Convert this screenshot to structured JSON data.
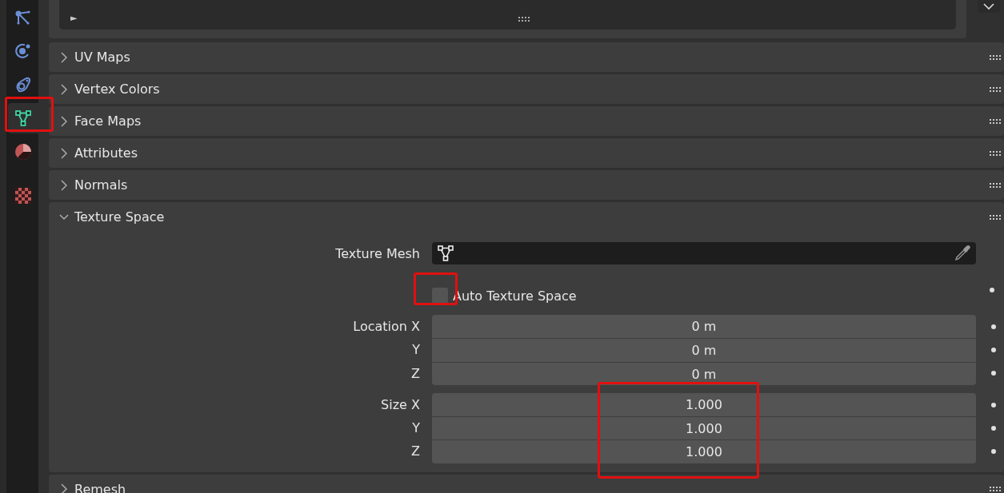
{
  "sidebar": {
    "tabs": [
      {
        "kind": "particles",
        "selected": false
      },
      {
        "kind": "physics",
        "selected": false
      },
      {
        "kind": "constraints",
        "selected": false
      },
      {
        "kind": "mesh",
        "selected": true
      },
      {
        "kind": "material",
        "selected": false
      },
      {
        "kind": "texture",
        "selected": false
      }
    ]
  },
  "top_panel": {
    "toggle": "►"
  },
  "panels": [
    {
      "title": "UV Maps",
      "expanded": false
    },
    {
      "title": "Vertex Colors",
      "expanded": false
    },
    {
      "title": "Face Maps",
      "expanded": false
    },
    {
      "title": "Attributes",
      "expanded": false
    },
    {
      "title": "Normals",
      "expanded": false
    },
    {
      "title": "Texture Space",
      "expanded": true
    },
    {
      "title": "Remesh",
      "expanded": false
    }
  ],
  "texture_space": {
    "texture_mesh": {
      "label": "Texture Mesh"
    },
    "auto_texture_space": {
      "label": "Auto Texture Space",
      "checked": false
    },
    "location": [
      {
        "label": "Location X",
        "value": "0 m"
      },
      {
        "label": "Y",
        "value": "0 m"
      },
      {
        "label": "Z",
        "value": "0 m"
      }
    ],
    "size": [
      {
        "label": "Size X",
        "value": "1.000"
      },
      {
        "label": "Y",
        "value": "1.000"
      },
      {
        "label": "Z",
        "value": "1.000"
      }
    ]
  }
}
